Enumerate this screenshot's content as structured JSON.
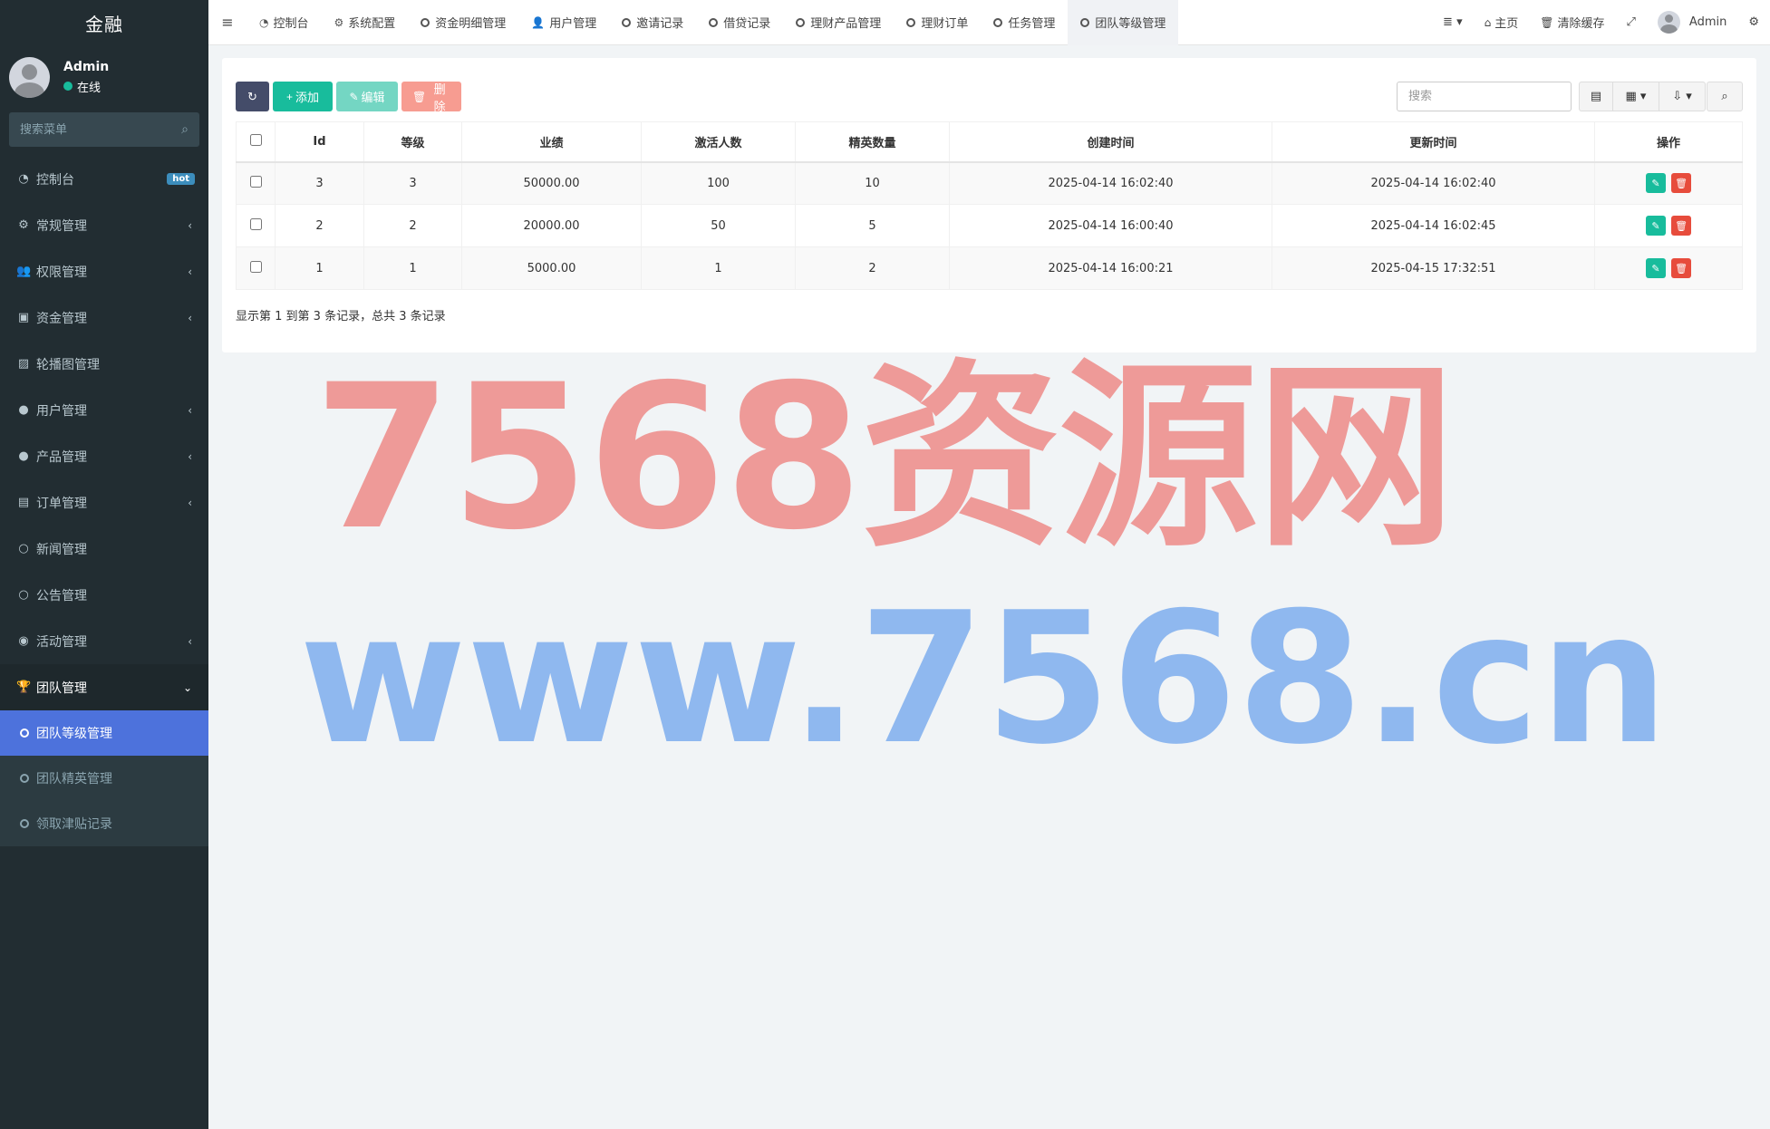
{
  "app": {
    "title": "金融"
  },
  "user": {
    "name": "Admin",
    "status": "在线"
  },
  "sidebar": {
    "search_placeholder": "搜索菜单",
    "items": [
      {
        "label": "控制台",
        "icon": "dashboard-icon",
        "glyph": "◔",
        "badge": "hot"
      },
      {
        "label": "常规管理",
        "icon": "cogs-icon",
        "glyph": "⚙",
        "chevron": "‹"
      },
      {
        "label": "权限管理",
        "icon": "users-icon",
        "glyph": "👥",
        "chevron": "‹"
      },
      {
        "label": "资金管理",
        "icon": "money-icon",
        "glyph": "▣",
        "chevron": "‹"
      },
      {
        "label": "轮播图管理",
        "icon": "image-icon",
        "glyph": "▨"
      },
      {
        "label": "用户管理",
        "icon": "user-circle-icon",
        "glyph": "●",
        "chevron": "‹"
      },
      {
        "label": "产品管理",
        "icon": "product-icon",
        "glyph": "●",
        "chevron": "‹"
      },
      {
        "label": "订单管理",
        "icon": "list-icon",
        "glyph": "▤",
        "chevron": "‹"
      },
      {
        "label": "新闻管理",
        "icon": "circle-icon",
        "glyph": "○"
      },
      {
        "label": "公告管理",
        "icon": "circle-icon",
        "glyph": "○"
      },
      {
        "label": "活动管理",
        "icon": "play-circle-icon",
        "glyph": "◉",
        "chevron": "‹"
      },
      {
        "label": "团队管理",
        "icon": "trophy-icon",
        "glyph": "🏆",
        "chevron": "⌄"
      }
    ],
    "subitems": [
      {
        "label": "团队等级管理"
      },
      {
        "label": "团队精英管理"
      },
      {
        "label": "领取津贴记录"
      }
    ]
  },
  "topbar": {
    "menu_glyph": "≡",
    "tabs": [
      {
        "label": "控制台",
        "icon": "dashboard-icon",
        "glyph": "◔"
      },
      {
        "label": "系统配置",
        "icon": "gear-icon",
        "glyph": "⚙"
      },
      {
        "label": "资金明细管理",
        "icon": "circle-icon"
      },
      {
        "label": "用户管理",
        "icon": "user-icon",
        "glyph": "👤"
      },
      {
        "label": "邀请记录",
        "icon": "circle-icon"
      },
      {
        "label": "借贷记录",
        "icon": "circle-icon"
      },
      {
        "label": "理财产品管理",
        "icon": "circle-icon"
      },
      {
        "label": "理财订单",
        "icon": "circle-icon"
      },
      {
        "label": "任务管理",
        "icon": "circle-icon"
      },
      {
        "label": "团队等级管理",
        "icon": "circle-icon"
      }
    ],
    "right": {
      "menu_glyph": "≣ ▾",
      "home": "主页",
      "home_glyph": "⌂",
      "clear_cache": "清除缓存",
      "clear_glyph": "🗑",
      "fullscreen_glyph": "⤢",
      "admin": "Admin",
      "settings_glyph": "⚙"
    }
  },
  "toolbar": {
    "refresh_glyph": "↻",
    "add_label": "添加",
    "add_glyph": "+",
    "edit_label": "编辑",
    "edit_glyph": "✎",
    "delete_label": "删除",
    "delete_glyph": "🗑",
    "search_placeholder": "搜索",
    "view_glyph": "▤",
    "columns_glyph": "▦ ▾",
    "export_glyph": "⇩ ▾",
    "search_glyph": "⌕"
  },
  "table": {
    "headers": [
      "Id",
      "等级",
      "业绩",
      "激活人数",
      "精英数量",
      "创建时间",
      "更新时间",
      "操作"
    ],
    "rows": [
      [
        "3",
        "3",
        "50000.00",
        "100",
        "10",
        "2025-04-14 16:02:40",
        "2025-04-14 16:02:40"
      ],
      [
        "2",
        "2",
        "20000.00",
        "50",
        "5",
        "2025-04-14 16:00:40",
        "2025-04-14 16:02:45"
      ],
      [
        "1",
        "1",
        "5000.00",
        "1",
        "2",
        "2025-04-14 16:00:21",
        "2025-04-15 17:32:51"
      ]
    ],
    "action_edit_glyph": "✎",
    "action_delete_glyph": "🗑"
  },
  "pagination": {
    "summary": "显示第 1 到第 3 条记录，总共 3 条记录"
  },
  "watermark": {
    "line1": "7568资源网",
    "line2": "www.7568.cn"
  },
  "colors": {
    "sidebar_bg": "#222d32",
    "active": "#4d72dc",
    "success": "#18bc9c",
    "danger": "#e74c3c"
  }
}
